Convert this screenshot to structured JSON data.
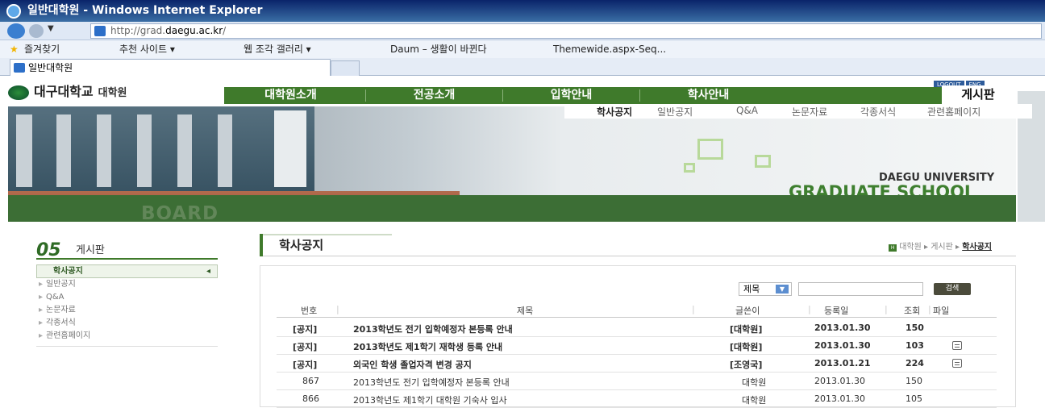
{
  "browser": {
    "title": "일반대학원 - Windows Internet Explorer",
    "url_prefix": "http://grad.",
    "url_domain": "daegu.ac.kr",
    "url_suffix": "/",
    "favorites_label": "즐겨찾기",
    "fav_links": [
      "추천 사이트 ▾",
      "웹 조각 갤러리 ▾",
      "Daum – 생활이 바뀐다",
      "Themewide.aspx-Seq..."
    ],
    "tab_title": "일반대학원"
  },
  "site": {
    "logo_name": "대구대학교",
    "logo_sub": "대학원",
    "top_buttons": [
      "LOGOUT",
      "ENG"
    ],
    "gnb": [
      "대학원소개",
      "전공소개",
      "입학안내",
      "학사안내"
    ],
    "gnb_current": "게시판",
    "lnb": [
      "학사공지",
      "일반공지",
      "Q&A",
      "논문자료",
      "각종서식",
      "관련홈페이지"
    ],
    "hero_en_top": "DAEGU UNIVERSITY",
    "hero_en_bottom": "GRADUATE SCHOOL",
    "hero_board": "BOARD"
  },
  "sidebar": {
    "number": "05",
    "title": "게시판",
    "items": [
      "학사공지",
      "일반공지",
      "Q&A",
      "논문자료",
      "각종서식",
      "관련홈페이지"
    ]
  },
  "content": {
    "title": "학사공지",
    "breadcrumb": [
      "대학원",
      "게시판",
      "학사공지"
    ],
    "search": {
      "select": "제목",
      "button": "검색"
    },
    "columns": [
      "번호",
      "제목",
      "글쓴이",
      "등록일",
      "조회",
      "파일"
    ],
    "rows": [
      {
        "no": "[공지]",
        "title": "2013학년도 전기 입학예정자 본등록 안내",
        "writer": "[대학원]",
        "date": "2013.01.30",
        "views": "150"
      },
      {
        "no": "[공지]",
        "title": "2013학년도 제1학기 재학생 등록 안내",
        "writer": "[대학원]",
        "date": "2013.01.30",
        "views": "103"
      },
      {
        "no": "[공지]",
        "title": "외국인 학생 졸업자격 변경 공지",
        "writer": "[조영국]",
        "date": "2013.01.21",
        "views": "224"
      },
      {
        "no": "867",
        "title": "2013학년도 전기 입학예정자 본등록 안내",
        "writer": "대학원",
        "date": "2013.01.30",
        "views": "150"
      },
      {
        "no": "866",
        "title": "2013학년도 제1학기 대학원 기숙사 입사",
        "writer": "대학원",
        "date": "2013.01.30",
        "views": "105"
      }
    ]
  }
}
